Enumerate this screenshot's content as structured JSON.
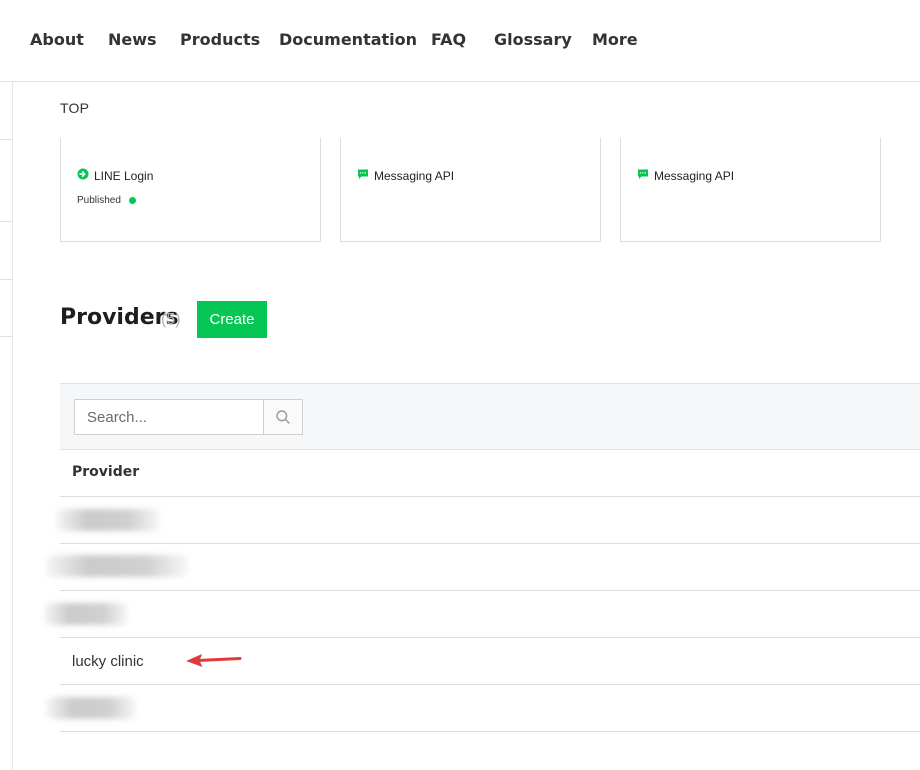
{
  "nav": {
    "items": [
      "About",
      "News",
      "Products",
      "Documentation",
      "FAQ",
      "Glossary",
      "More"
    ]
  },
  "top_section": {
    "label": "TOP",
    "cards": [
      {
        "title": "LINE Login",
        "icon": "line-login-icon",
        "status": "Published"
      },
      {
        "title": "Messaging API",
        "icon": "messaging-api-icon"
      },
      {
        "title": "Messaging API",
        "icon": "messaging-api-icon"
      }
    ]
  },
  "providers": {
    "title": "Providers",
    "count": "(5)",
    "create_label": "Create",
    "search_placeholder": "Search...",
    "column_header": "Provider",
    "rows": [
      "",
      "",
      "",
      "lucky clinic",
      ""
    ]
  },
  "colors": {
    "accent": "#06c755",
    "annotation_arrow": "#e03a3a"
  }
}
